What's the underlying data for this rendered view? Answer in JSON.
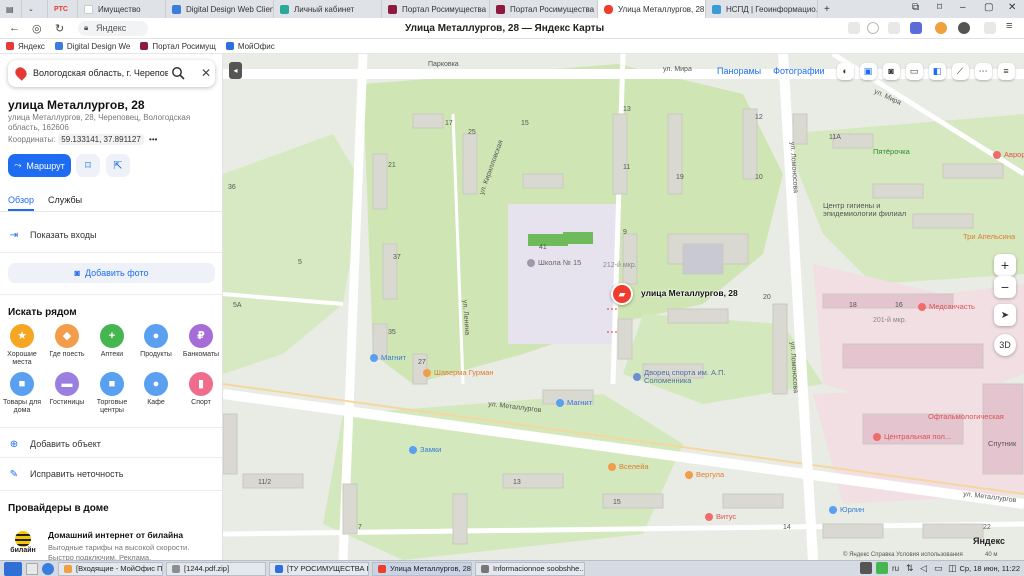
{
  "browser": {
    "tabs": [
      {
        "label": "",
        "color": "#e53935"
      },
      {
        "label": "Имущество",
        "color": "#ffffff"
      },
      {
        "label": "Digital Design Web Client",
        "color": "#3b7ddd"
      },
      {
        "label": "Личный кабинет",
        "color": "#2aa89a"
      },
      {
        "label": "Портал Росимущества",
        "color": "#8e1b3f"
      },
      {
        "label": "Портал Росимущества",
        "color": "#8e1b3f"
      },
      {
        "label": "Улица Металлургов, 28",
        "color": "#f03c2d"
      },
      {
        "label": "НСПД | Геоинформацио...",
        "color": "#3b9bd4"
      }
    ],
    "tab_badge": "РТС",
    "window_title": "Улица Металлургов, 28 — Яндекс Карты",
    "url": "Яндекс",
    "bookmarks": [
      {
        "label": "Яндекс",
        "color": "#e53935"
      },
      {
        "label": "Digital Design We",
        "color": "#3b7ddd"
      },
      {
        "label": "Портал Росимущ",
        "color": "#8e1b3f"
      },
      {
        "label": "МойОфис",
        "color": "#2c6fe0"
      }
    ]
  },
  "search": {
    "value": "Вологодская область, г. Череповец, ..."
  },
  "place": {
    "title": "улица Металлургов, 28",
    "address": "улица Металлургов, 28, Череповец, Вологодская область, 162606",
    "coords_label": "Координаты:",
    "coords_value": "59.133141, 37.891127",
    "coords_more": "•••",
    "route_label": "Маршрут"
  },
  "panel_tabs": [
    "Обзор",
    "Службы"
  ],
  "links": {
    "entrances": "Показать входы",
    "add_photo": "Добавить фото",
    "add_object": "Добавить объект",
    "fix_error": "Исправить неточность"
  },
  "nearby": {
    "title": "Искать рядом",
    "categories": [
      {
        "label": "Хорошие места",
        "color": "#f5a623",
        "glyph": "★"
      },
      {
        "label": "Где поесть",
        "color": "#f39c4a",
        "glyph": "◆"
      },
      {
        "label": "Аптеки",
        "color": "#46b650",
        "glyph": "+"
      },
      {
        "label": "Продукты",
        "color": "#5aa0f0",
        "glyph": "●"
      },
      {
        "label": "Банкоматы",
        "color": "#a66cd8",
        "glyph": "₽"
      },
      {
        "label": "Товары для дома",
        "color": "#5aa0f0",
        "glyph": "■"
      },
      {
        "label": "Гостиницы",
        "color": "#9b7fe0",
        "glyph": "▬"
      },
      {
        "label": "Торговые центры",
        "color": "#5aa0f0",
        "glyph": "■"
      },
      {
        "label": "Кафе",
        "color": "#5aa0f0",
        "glyph": "●"
      },
      {
        "label": "Спорт",
        "color": "#f06c8c",
        "glyph": "▮"
      }
    ]
  },
  "providers": {
    "title": "Провайдеры в доме",
    "name": "Домашний интернет от билайна",
    "description": "Выгодные тарифы на высокой скорости. Быстро подключим. Реклама.",
    "logo_text": "билайн"
  },
  "map": {
    "top_links": [
      "Панорамы",
      "Фотографии"
    ],
    "marker_label": "улица Металлургов, 28",
    "labels": {
      "street_mira": "ул. Мира",
      "street_mira2": "ул. Мира",
      "street_metallurgov": "ул. Металлургов",
      "street_metallurgov2": "ул. Металлургов",
      "street_lomonosova": "ул. Ломоносова",
      "street_lomonosova2": "ул. Ломоносова",
      "street_lenina": "ул. Ленина",
      "street_kirillovskaya": "ул. Кирилловская",
      "parkovka": "Парковка",
      "school": "Школа № 15",
      "microdistrict": "212-й мкр.",
      "microdistrict2": "201-й мкр.",
      "palace": "Дворец спорта им. А.П. Соломенника",
      "center": "Центр гигиены и эпидемиологии филиал",
      "shaverma": "Шаверма Гурман",
      "pyaterochka": "Пятёрочка",
      "magnit1": "Магнит",
      "magnit2": "Магнит",
      "zamki": "Замки",
      "vseleya": "Вселейа",
      "vitus": "Витус",
      "medsanchast": "Медсанчасть",
      "three_apelsina": "Три Апельсина",
      "central_polyclinic": "Центральная пол...",
      "ophthalm": "Офтальмологическая",
      "avrora": "Аврора",
      "yurlin": "Юрлин",
      "vergula": "Вергула",
      "sputnik": "Спутник"
    },
    "house_numbers": [
      "17",
      "15",
      "13",
      "11",
      "11А",
      "25",
      "21",
      "19",
      "41",
      "18",
      "16",
      "9",
      "37",
      "35",
      "27",
      "12",
      "10",
      "20",
      "36",
      "5",
      "11/2",
      "5А",
      "7",
      "13",
      "15",
      "14",
      "22"
    ],
    "copyright": "© Яндекс  Справка  Условия использования",
    "scale": "40 м",
    "logo": "Яндекс",
    "mode_3d": "3D"
  },
  "taskbar": {
    "items": [
      "[Входящие - МойОфис П...",
      "[1244.pdf.zip]",
      "[ТУ РОСИМУЩЕСТВА В В...",
      "Улица Металлургов, 28 ...",
      "Informacionnoe soobshhe..."
    ],
    "clock": "Ср, 18 июн, 11:22"
  }
}
